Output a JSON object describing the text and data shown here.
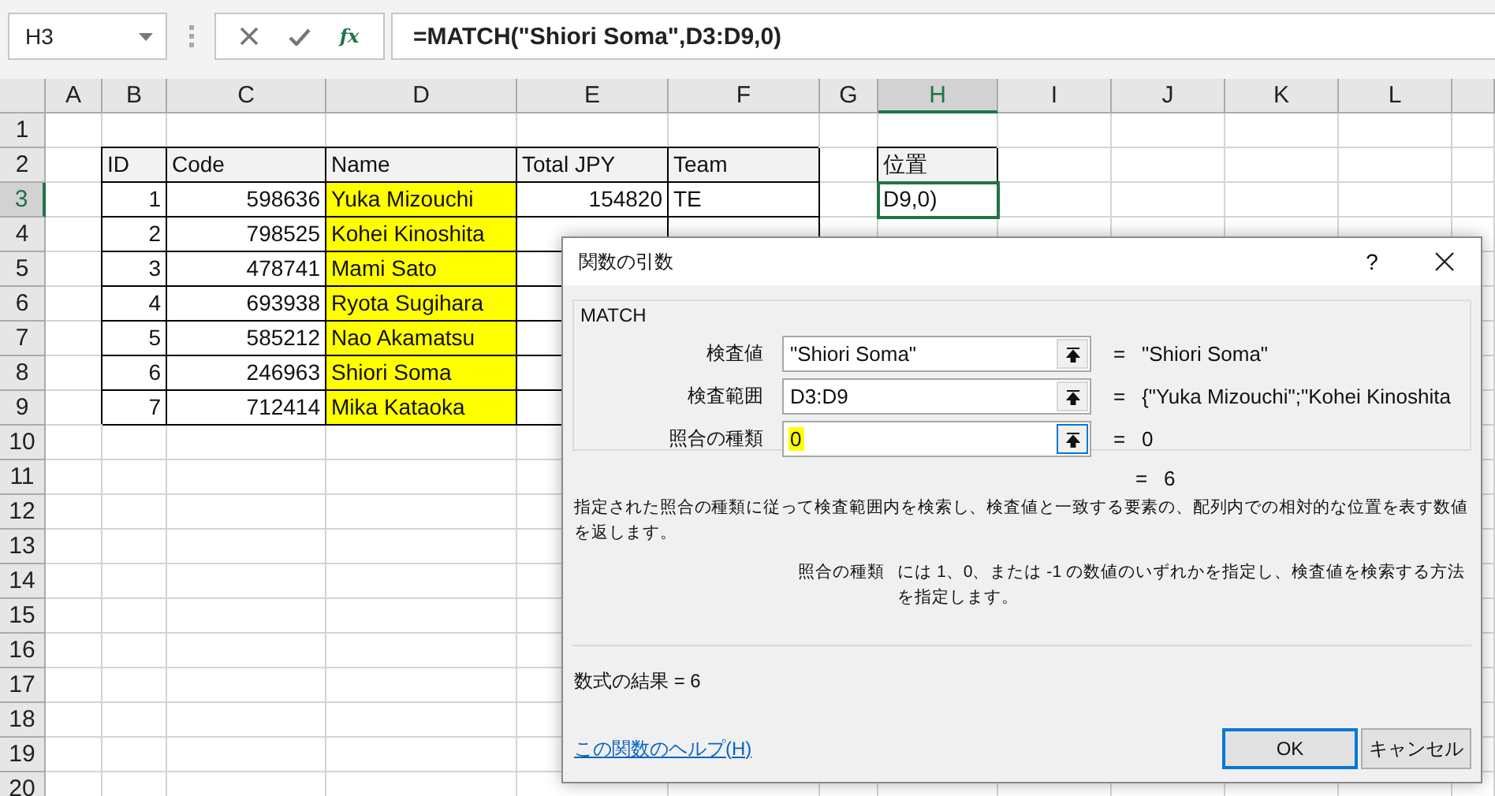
{
  "name_box": {
    "value": "H3"
  },
  "formula_bar": {
    "function_button": "fx",
    "formula": "=MATCH(\"Shiori Soma\",D3:D9,0)"
  },
  "sheet": {
    "columns": [
      {
        "label": "A",
        "selected": false
      },
      {
        "label": "B",
        "selected": false
      },
      {
        "label": "C",
        "selected": false
      },
      {
        "label": "D",
        "selected": false
      },
      {
        "label": "E",
        "selected": false
      },
      {
        "label": "F",
        "selected": false
      },
      {
        "label": "G",
        "selected": false
      },
      {
        "label": "H",
        "selected": true
      },
      {
        "label": "I",
        "selected": false
      },
      {
        "label": "J",
        "selected": false
      },
      {
        "label": "K",
        "selected": false
      },
      {
        "label": "L",
        "selected": false
      }
    ],
    "rows": [
      {
        "number": "1",
        "selected": false
      },
      {
        "number": "2",
        "selected": false
      },
      {
        "number": "3",
        "selected": true
      },
      {
        "number": "4",
        "selected": false
      },
      {
        "number": "5",
        "selected": false
      },
      {
        "number": "6",
        "selected": false
      },
      {
        "number": "7",
        "selected": false
      },
      {
        "number": "8",
        "selected": false
      },
      {
        "number": "9",
        "selected": false
      },
      {
        "number": "10",
        "selected": false
      },
      {
        "number": "11",
        "selected": false
      },
      {
        "number": "12",
        "selected": false
      },
      {
        "number": "13",
        "selected": false
      },
      {
        "number": "14",
        "selected": false
      },
      {
        "number": "15",
        "selected": false
      },
      {
        "number": "16",
        "selected": false
      },
      {
        "number": "17",
        "selected": false
      },
      {
        "number": "18",
        "selected": false
      },
      {
        "number": "19",
        "selected": false
      },
      {
        "number": "20",
        "selected": false
      }
    ]
  },
  "table": {
    "columns": [
      {
        "label": "ID",
        "kind": "number"
      },
      {
        "label": "Code",
        "kind": "number"
      },
      {
        "label": "Name",
        "kind": "text",
        "color": "#ffff00"
      },
      {
        "label": "Total JPY",
        "kind": "number"
      },
      {
        "label": "Team",
        "kind": "text"
      }
    ],
    "rows": [
      [
        "1",
        "598636",
        "Yuka Mizouchi",
        "154820",
        "TE"
      ],
      [
        "2",
        "798525",
        "Kohei Kinoshita"
      ],
      [
        "3",
        "478741",
        "Mami Sato"
      ],
      [
        "4",
        "693938",
        "Ryota Sugihara"
      ],
      [
        "5",
        "585212",
        "Nao Akamatsu"
      ],
      [
        "6",
        "246963",
        "Shiori Soma"
      ],
      [
        "7",
        "712414",
        "Mika Kataoka"
      ]
    ]
  },
  "position_table": {
    "header": "位置",
    "cells": [
      {
        "text": "D9,0)",
        "selected": true
      }
    ]
  },
  "dialog": {
    "title": "関数の引数",
    "help": "?",
    "function_name": "MATCH",
    "arguments": [
      {
        "label": "検査値",
        "value": "\"Shiori Soma\"",
        "sign": "=",
        "result": "\"Shiori Soma\"",
        "highlighted": false,
        "focused": false
      },
      {
        "label": "検査範囲",
        "value": "D3:D9",
        "sign": "=",
        "result": "{\"Yuka Mizouchi\";\"Kohei Kinoshita",
        "highlighted": false,
        "focused": false
      },
      {
        "label": "照合の種類",
        "value": "0",
        "sign": "=",
        "result": "0",
        "highlighted": true,
        "focused": true
      }
    ],
    "function_result": {
      "sign": "=",
      "value": "6"
    },
    "description": "指定された照合の種類に従って検査範囲内を検索し、検査値と一致する要素の、配列内での相対的な位置を表す数値を返します。",
    "argument_help": {
      "label": "照合の種類",
      "text": "には 1、0、または -1 の数値のいずれかを指定し、検査値を検索する方法を指定します。"
    },
    "formula_result": {
      "label": "数式の結果 =",
      "value": "6"
    },
    "help_link": "この関数のヘルプ(H)",
    "buttons": [
      {
        "label": "OK",
        "default": true
      },
      {
        "label": "キャンセル",
        "default": false
      }
    ]
  }
}
